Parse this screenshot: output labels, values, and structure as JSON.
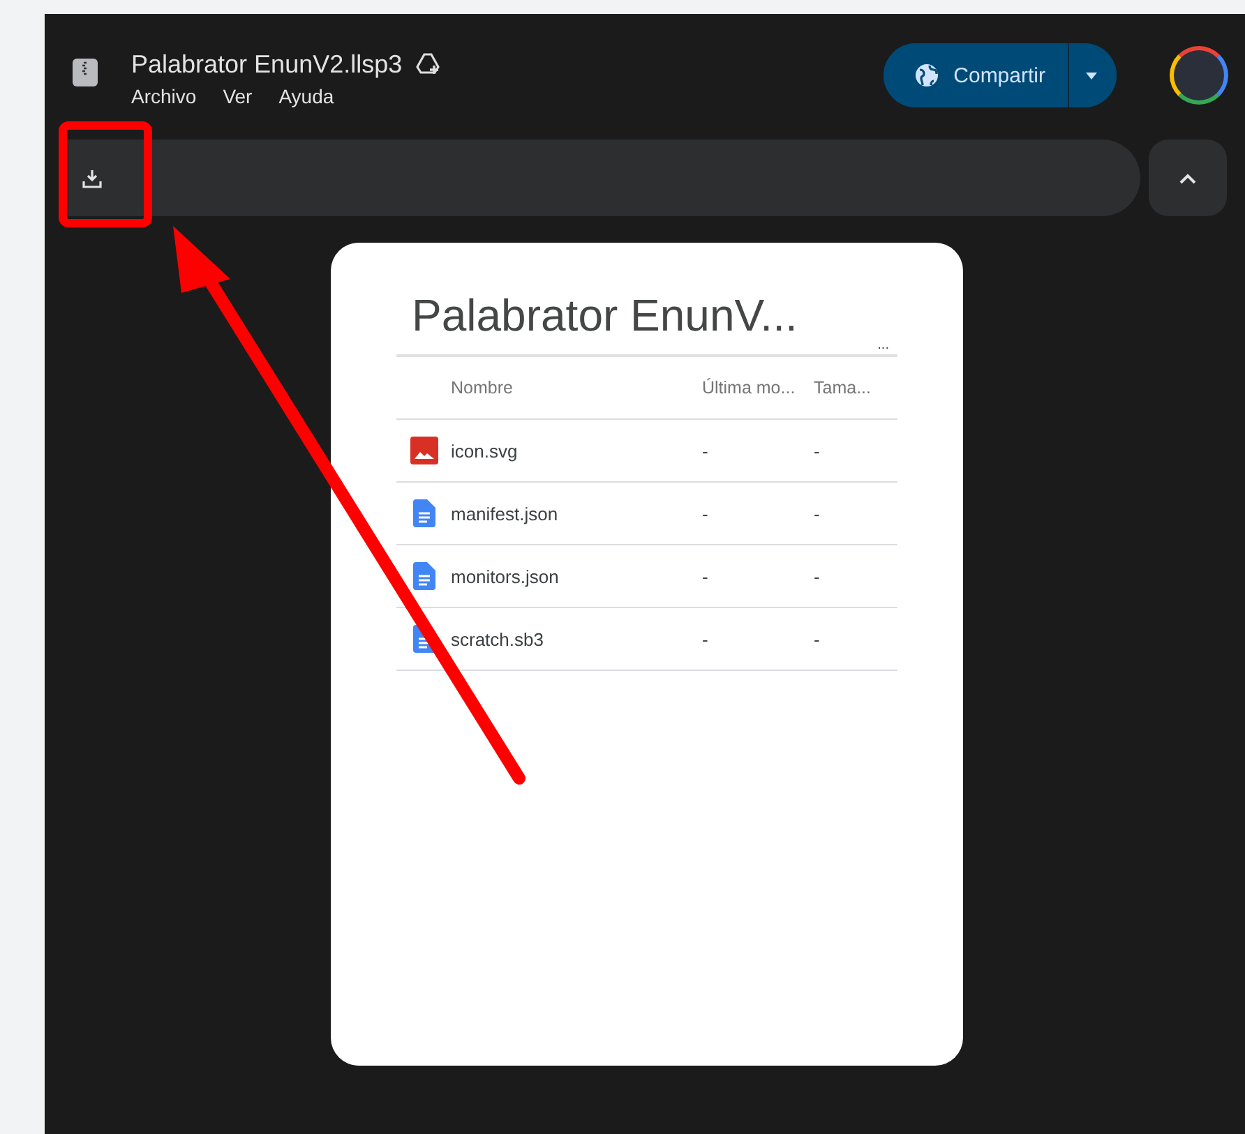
{
  "header": {
    "title": "Palabrator EnunV2.llsp3",
    "menus": [
      "Archivo",
      "Ver",
      "Ayuda"
    ],
    "share_button": "Compartir"
  },
  "preview": {
    "title": "Palabrator EnunV...",
    "more": "...",
    "columns": [
      "Nombre",
      "Última mo...",
      "Tama..."
    ],
    "rows": [
      {
        "kind": "image",
        "name": "icon.svg",
        "modified": "-",
        "size": "-"
      },
      {
        "kind": "doc",
        "name": "manifest.json",
        "modified": "-",
        "size": "-"
      },
      {
        "kind": "doc",
        "name": "monitors.json",
        "modified": "-",
        "size": "-"
      },
      {
        "kind": "doc",
        "name": "scratch.sb3",
        "modified": "-",
        "size": "-"
      }
    ]
  }
}
